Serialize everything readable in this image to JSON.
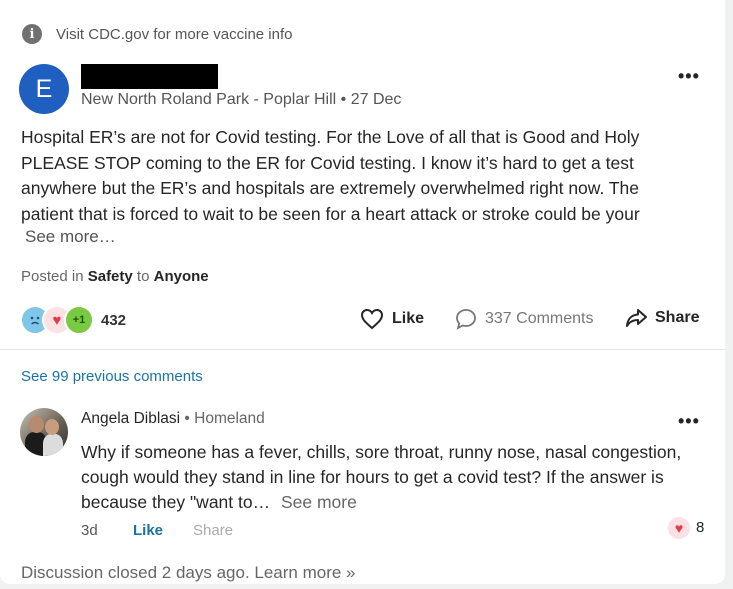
{
  "banner": {
    "text": "Visit CDC.gov for more vaccine info",
    "icon": "info-icon"
  },
  "post": {
    "avatar_letter": "E",
    "avatar_color": "#1e5fbf",
    "author_redacted": true,
    "meta": "New North Roland Park - Poplar Hill • 27 Dec",
    "lines": [
      "Hospital ER’s are not for Covid testing. For the Love of all that is Good and Holy",
      "PLEASE STOP coming to the ER for Covid testing. I know it’s hard to get a test",
      "anywhere but the ER’s and hospitals are extremely overwhelmed right now. The",
      "patient that is forced to wait to be seen for a heart attack or stroke could be your"
    ],
    "see_more": "See more…",
    "posted_prefix": "Posted in",
    "posted_category": "Safety",
    "posted_mid": "to",
    "posted_audience": "Anyone",
    "reaction_plus_label": "+1",
    "reaction_count": "432",
    "actions": {
      "like": "Like",
      "comments": "337 Comments",
      "share": "Share"
    }
  },
  "comments": {
    "previous_link": "See 99 previous comments",
    "items": [
      {
        "author": "Angela Diblasi",
        "location": "Homeland",
        "lines": [
          "Why if someone has a fever, chills, sore throat, runny nose, nasal congestion,",
          "cough would they stand in line for hours to get a covid test? If the answer is"
        ],
        "last_line": "because they \"want to…",
        "see_more": "See more",
        "time": "3d",
        "like": "Like",
        "share": "Share",
        "reaction_count": "8"
      }
    ]
  },
  "footer": {
    "text": "Discussion closed 2 days ago. Learn more »"
  },
  "colors": {
    "link": "#1a73a8",
    "heart": "#e33a4a",
    "plus": "#7ac943"
  }
}
